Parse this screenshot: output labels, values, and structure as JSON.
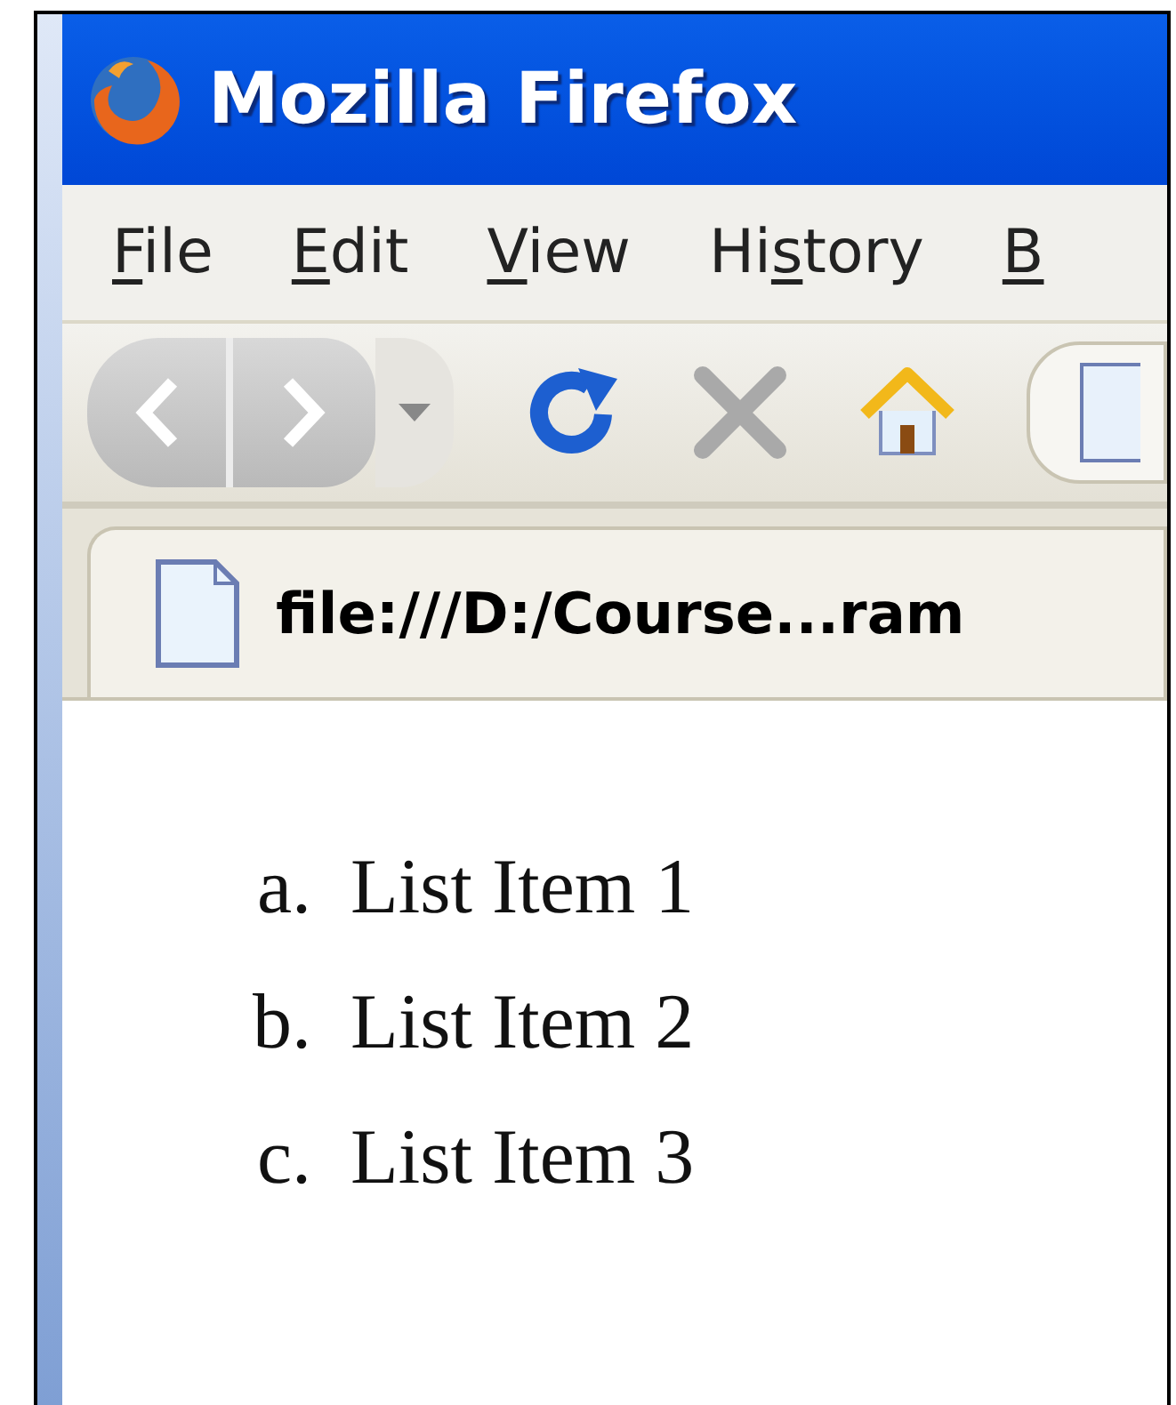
{
  "window": {
    "title": "Mozilla Firefox"
  },
  "menu": [
    {
      "access_key": "F",
      "after": "ile"
    },
    {
      "access_key": "E",
      "after": "dit"
    },
    {
      "access_key": "V",
      "after": "iew"
    },
    {
      "before": "Hi",
      "access_key": "s",
      "after": "tory"
    },
    {
      "access_key": "B"
    }
  ],
  "tab": {
    "title": "file:///D:/Course...ram"
  },
  "list": [
    {
      "marker": "a.",
      "text": "List Item 1"
    },
    {
      "marker": "b.",
      "text": "List Item 2"
    },
    {
      "marker": "c.",
      "text": "List Item 3"
    }
  ]
}
